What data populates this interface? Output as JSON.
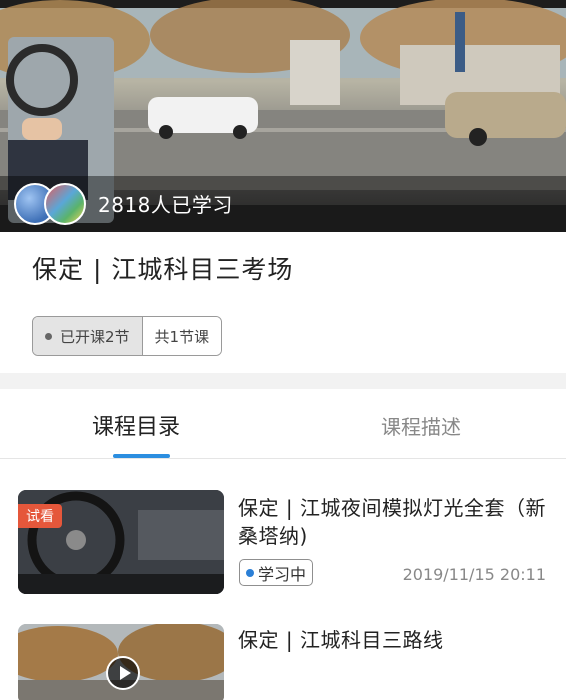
{
  "hero": {
    "learner_count": "2818人已学习",
    "video_scene_icon": "street-scene-video"
  },
  "course": {
    "title": "保定 | 江城科目三考场",
    "badge_opened": "已开课2节",
    "badge_total": "共1节课"
  },
  "tabs": [
    {
      "label": "课程目录",
      "active": true
    },
    {
      "label": "课程描述",
      "active": false
    }
  ],
  "lessons": [
    {
      "title": "保定 | 江城夜间模拟灯光全套（新桑塔纳)",
      "trial_label": "试看",
      "status": "学习中",
      "date": "2019/11/15 20:11"
    },
    {
      "title": "保定 | 江城科目三路线"
    }
  ],
  "colors": {
    "accent_blue": "#2b8ee0",
    "trial_tag": "#e5573b",
    "status_dot": "#2b7fd6"
  }
}
